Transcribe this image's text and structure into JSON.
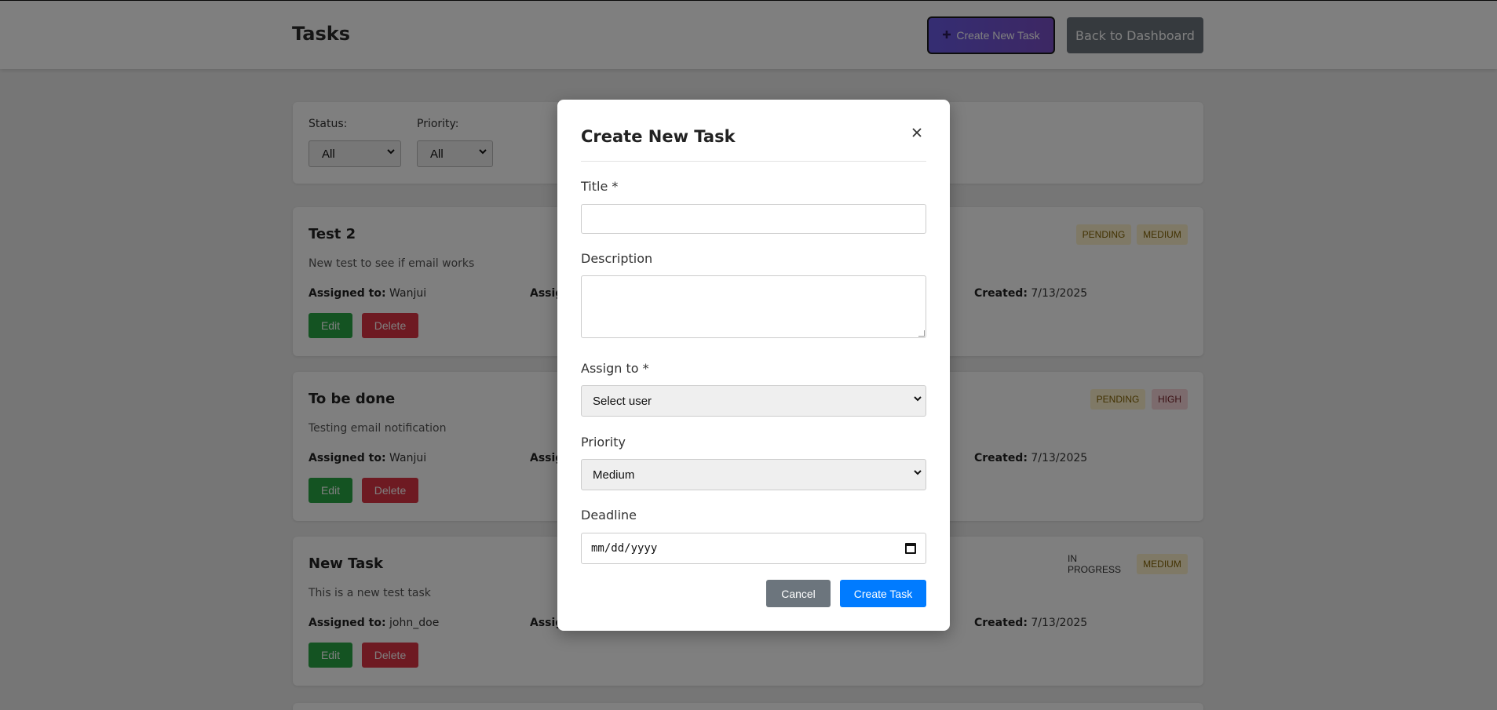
{
  "header": {
    "title": "Tasks",
    "create_button": "Create New Task",
    "back_button": "Back to Dashboard"
  },
  "filters": {
    "status_label": "Status:",
    "status_value": "All",
    "priority_label": "Priority:",
    "priority_value": "All"
  },
  "tasks": [
    {
      "title": "Test 2",
      "description": "New test to see if email works",
      "assigned_label": "Assigned to:",
      "assigned_to": "Wanjui",
      "assign_partial": "Assig",
      "created_label": "Created:",
      "created": "7/13/2025",
      "status": "PENDING",
      "priority": "MEDIUM",
      "edit_label": "Edit",
      "delete_label": "Delete"
    },
    {
      "title": "To be done",
      "description": "Testing email notification",
      "assigned_label": "Assigned to:",
      "assigned_to": "Wanjui",
      "assign_partial": "Assig",
      "created_label": "Created:",
      "created": "7/13/2025",
      "status": "PENDING",
      "priority": "HIGH",
      "edit_label": "Edit",
      "delete_label": "Delete"
    },
    {
      "title": "New Task",
      "description": "This is a new test task",
      "assigned_label": "Assigned to:",
      "assigned_to": "john_doe",
      "assign_partial": "Assig",
      "created_label": "Created:",
      "created": "7/13/2025",
      "status": "IN PROGRESS",
      "priority": "MEDIUM",
      "edit_label": "Edit",
      "delete_label": "Delete"
    }
  ],
  "modal": {
    "title": "Create New Task",
    "close_symbol": "×",
    "title_label": "Title *",
    "title_value": "",
    "description_label": "Description",
    "description_value": "",
    "assign_label": "Assign to *",
    "assign_value": "Select user",
    "priority_label": "Priority",
    "priority_value": "Medium",
    "deadline_label": "Deadline",
    "deadline_placeholder": "mm/dd/yyyy",
    "cancel_label": "Cancel",
    "submit_label": "Create Task"
  },
  "colors": {
    "edit": "#28a745",
    "delete": "#dc3545",
    "primary": "#007bff",
    "secondary": "#6c757d"
  },
  "icons": {
    "create": "plus-icon",
    "close": "close-icon",
    "calendar": "calendar-icon",
    "chevron": "chevron-down-icon"
  }
}
